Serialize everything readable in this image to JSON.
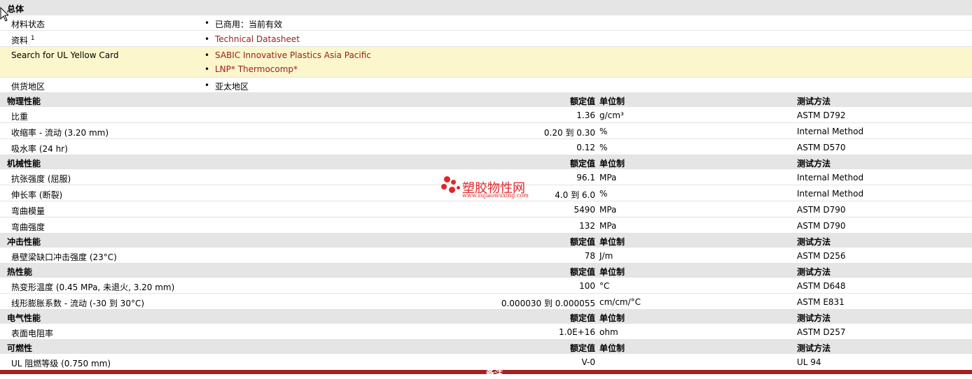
{
  "general": {
    "title": "总体",
    "rows": [
      {
        "label": "材料状态",
        "items": [
          "已商用：当前有效"
        ]
      },
      {
        "label": "资料",
        "sup": "1",
        "items": [
          "Technical Datasheet"
        ]
      },
      {
        "label": "Search for UL Yellow Card",
        "items": [
          "SABIC Innovative Plastics Asia Pacific",
          "LNP* Thermocomp*"
        ]
      },
      {
        "label": "供货地区",
        "items": [
          "亚太地区"
        ]
      }
    ]
  },
  "headers": {
    "value": "额定值",
    "unit": "单位制",
    "method": "测试方法"
  },
  "sections": [
    {
      "title": "物理性能",
      "rows": [
        {
          "label": "比重",
          "value": "1.36",
          "unit": "g/cm³",
          "method": "ASTM D792"
        },
        {
          "label": "收缩率  - 流动  (3.20 mm)",
          "value": "0.20 到  0.30",
          "unit": "%",
          "method": "Internal Method"
        },
        {
          "label": "吸水率  (24 hr)",
          "value": "0.12",
          "unit": "%",
          "method": "ASTM D570"
        }
      ]
    },
    {
      "title": "机械性能",
      "rows": [
        {
          "label": "抗张强度  (屈服)",
          "value": "96.1",
          "unit": "MPa",
          "method": "Internal Method"
        },
        {
          "label": "伸长率  (断裂)",
          "value": "4.0 到  6.0",
          "unit": "%",
          "method": "Internal Method"
        },
        {
          "label": "弯曲模量",
          "value": "5490",
          "unit": "MPa",
          "method": "ASTM D790"
        },
        {
          "label": "弯曲强度",
          "value": "132",
          "unit": "MPa",
          "method": "ASTM D790"
        }
      ]
    },
    {
      "title": "冲击性能",
      "rows": [
        {
          "label": "悬壁梁缺口冲击强度  (23°C)",
          "value": "78",
          "unit": "J/m",
          "method": "ASTM D256"
        }
      ]
    },
    {
      "title": "热性能",
      "rows": [
        {
          "label": "热变形温度  (0.45 MPa, 未退火, 3.20 mm)",
          "value": "100",
          "unit": "°C",
          "method": "ASTM D648"
        },
        {
          "label": "线形膨胀系数  - 流动  (-30 到  30°C)",
          "value": "0.000030 到  0.000055",
          "unit": "cm/cm/°C",
          "method": "ASTM E831"
        }
      ]
    },
    {
      "title": "电气性能",
      "rows": [
        {
          "label": "表面电阻率",
          "value": "1.0E+16",
          "unit": "ohm",
          "method": "ASTM D257"
        }
      ]
    },
    {
      "title": "可燃性",
      "rows": [
        {
          "label": "UL 阻燃等级  (0.750 mm)",
          "value": "V-0",
          "unit": "",
          "method": "UL 94"
        }
      ]
    }
  ],
  "footer": {
    "label": "备注"
  },
  "watermark": {
    "name": "塑胶物性网",
    "url": "www.sujiaowuxing.com"
  },
  "colors": {
    "link": "#9b1c1c",
    "section_bg": "#e5e5e5",
    "highlight_bg": "#fbf6cc",
    "footer_bg": "#a41e22",
    "watermark": "#e0262b"
  }
}
